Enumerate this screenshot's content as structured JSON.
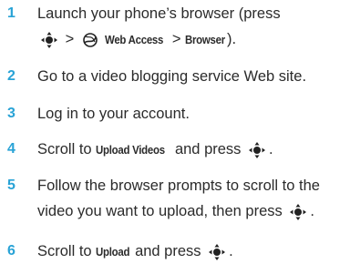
{
  "accent_color": "#29a3d6",
  "steps": [
    {
      "number": "1",
      "line1": "Launch your phone’s browser (press",
      "line2_gt1": ">",
      "line2_ui1": "Web Access",
      "line2_gt2": ">",
      "line2_ui2": "Browser",
      "line2_end": ")."
    },
    {
      "number": "2",
      "text": "Go to a video blogging service Web site."
    },
    {
      "number": "3",
      "text": "Log in to your account."
    },
    {
      "number": "4",
      "pre": "Scroll to",
      "ui": "Upload Videos",
      "post": "and press",
      "end": "."
    },
    {
      "number": "5",
      "line1": "Follow the browser prompts to scroll to the",
      "line2": "video you want to upload, then press",
      "end": "."
    },
    {
      "number": "6",
      "pre": "Scroll to",
      "ui": "Upload",
      "post": "and press",
      "end": "."
    }
  ],
  "icons": {
    "nav_key": "navigation-key-center-select-icon",
    "web_access": "web-access-globe-icon"
  }
}
